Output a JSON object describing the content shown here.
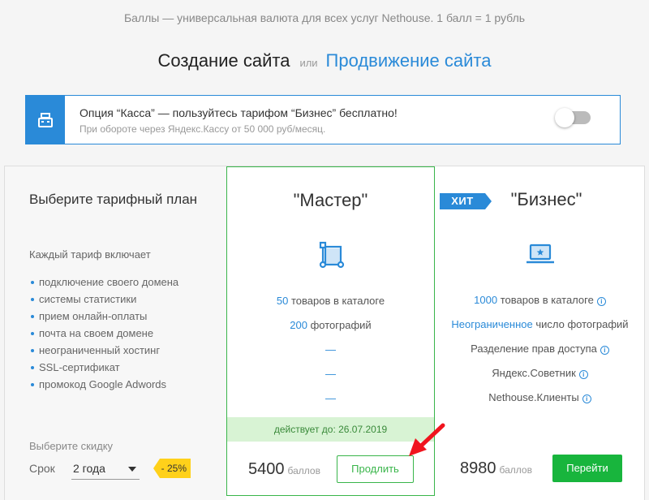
{
  "top_note": "Баллы — универсальная валюта для всех услуг Nethouse. 1 балл = 1 рубль",
  "switcher": {
    "active": "Создание сайта",
    "or": "или",
    "link": "Продвижение сайта"
  },
  "kassa": {
    "title": "Опция “Касса” — пользуйтесь тарифом “Бизнес” бесплатно!",
    "subtitle": "При обороте через Яндекс.Кассу от 50 000 руб/месяц.",
    "toggle_on": false
  },
  "left": {
    "heading": "Выберите тарифный план",
    "includes": "Каждый тариф включает",
    "features": [
      "подключение своего домена",
      "системы статистики",
      "прием онлайн-оплаты",
      "почта на своем домене",
      "неограниченный хостинг",
      "SSL-сертификат",
      "промокод Google Adwords"
    ],
    "discount_label": "Выберите скидку",
    "term_label": "Срок",
    "term_value": "2 года",
    "discount_badge": "- 25%"
  },
  "master": {
    "title": "\"Мастер\"",
    "icon": "tools-icon",
    "goods_num": "50",
    "goods_text": " товаров в каталоге",
    "photos_num": "200",
    "photos_text": " фотографий",
    "dash": "—",
    "valid_until": "действует до: 26.07.2019",
    "price": "5400",
    "unit": "баллов",
    "button": "Продлить"
  },
  "business": {
    "badge": "ХИТ",
    "title": "\"Бизнес\"",
    "icon": "laptop-star-icon",
    "goods_num": "1000",
    "goods_text": " товаров в каталоге",
    "photos_num": "Неограниченное",
    "photos_text": " число фотографий",
    "rights": "Разделение прав доступа",
    "advisor": "Яндекс.Советник",
    "clients": "Nethouse.Клиенты",
    "info_glyph": "i",
    "price": "8980",
    "unit": "баллов",
    "button": "Перейти"
  },
  "colors": {
    "accent_blue": "#2a8ad8",
    "green": "#39b54a",
    "button_green": "#18b53d",
    "badge_yellow": "#ffd11a",
    "arrow_red": "#f0141e"
  }
}
